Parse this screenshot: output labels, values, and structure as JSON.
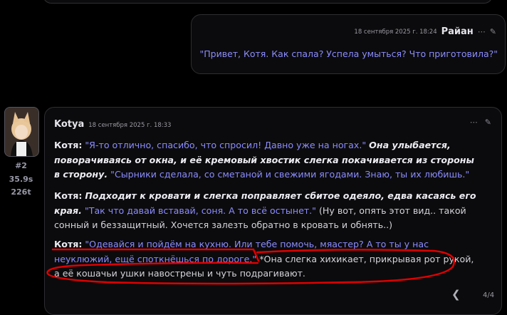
{
  "user_message": {
    "timestamp": "18 сентября 2025 г. 18:24",
    "author": "Райан",
    "text": "\"Привет, Котя. Как спала? Успела умыться? Что приготовила?\"",
    "menu_icon": "ellipsis-icon",
    "edit_icon": "pencil-icon"
  },
  "bot_message": {
    "author": "Kotya",
    "timestamp": "18 сентября 2025 г. 18:33",
    "rank": "#2",
    "time": "35.9s",
    "tokens": "226t",
    "paragraphs": [
      {
        "speaker": "Котя:",
        "quote1": "\"Я-то отлично, спасибо, что спросил! Давно уже на ногах.\"",
        "action": "Она улыбается, поворачиваясь от окна, и её кремовый хвостик слегка покачивается из стороны в сторону.",
        "quote2": "\"Сырники сделала, со сметаной и свежими ягодами. Знаю, ты их любишь.\""
      },
      {
        "speaker": "Котя:",
        "action": "Подходит к кровати и слегка поправляет сбитое одеяло, едва касаясь его края.",
        "quote": "\"Так что давай вставай, соня. А то всё остынет.\"",
        "tail": "(Ну вот, опять этот вид.. такой сонный и беззащитный. Хочется залезть обратно в кровать и обнять..)"
      },
      {
        "speaker": "Котя:",
        "quote": "\"Одевайся и пойдём на кухню. Или тебе помочь, мяастер? А то ты у нас неуклюжий, ещё споткнёшься по дороге.\"",
        "tail": "*Она слегка хихикает, прикрывая рот рукой, а её кошачьи ушки навострены и чуть подрагивают."
      }
    ],
    "counter": "4/4",
    "prev_icon": "chevron-left-icon"
  },
  "annotation_color": "#e00000"
}
